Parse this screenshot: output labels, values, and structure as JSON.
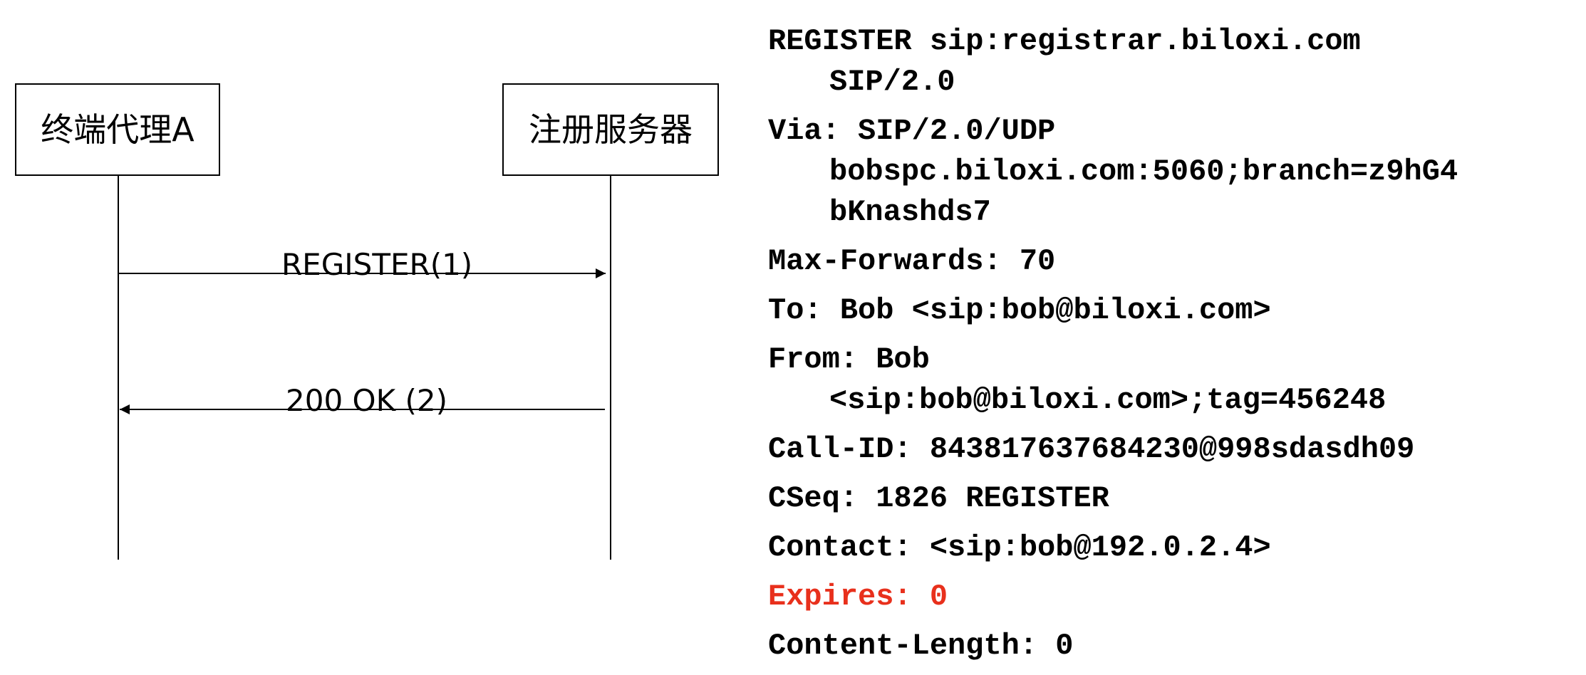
{
  "diagram": {
    "actor_a": "终端代理A",
    "actor_b": "注册服务器",
    "msg1": "REGISTER(1)",
    "msg2": "200 OK (2)"
  },
  "message": {
    "request_line": [
      "REGISTER sip:registrar.biloxi.com",
      "SIP/2.0"
    ],
    "via": [
      "Via: SIP/2.0/UDP",
      "bobspc.biloxi.com:5060;branch=z9hG4",
      "bKnashds7"
    ],
    "max_forwards": "Max-Forwards: 70",
    "to": "To: Bob <sip:bob@biloxi.com>",
    "from": [
      "From: Bob",
      "<sip:bob@biloxi.com>;tag=456248"
    ],
    "call_id": "Call-ID: 843817637684230@998sdasdh09",
    "cseq": "CSeq: 1826 REGISTER",
    "contact": "Contact: <sip:bob@192.0.2.4>",
    "expires": "Expires: 0",
    "content_length": "Content-Length: 0"
  },
  "colors": {
    "highlight": "#e8301c",
    "line": "#000000"
  }
}
